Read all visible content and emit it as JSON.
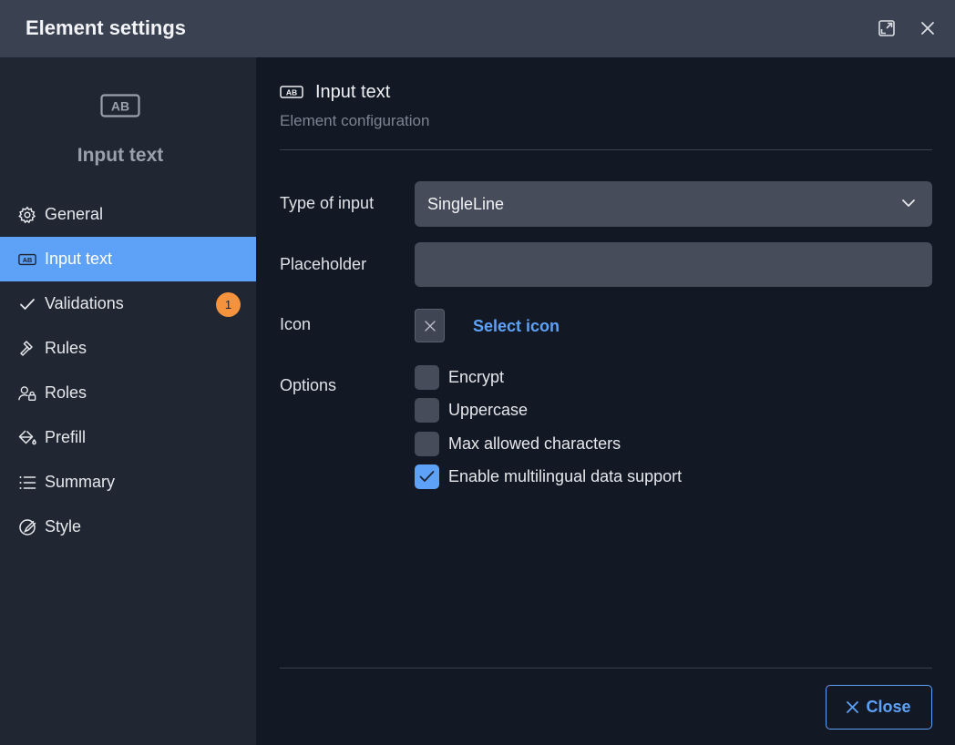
{
  "window": {
    "title": "Element settings"
  },
  "sidebar": {
    "header_title": "Input text",
    "items": [
      {
        "label": "General"
      },
      {
        "label": "Input text"
      },
      {
        "label": "Validations",
        "badge": "1"
      },
      {
        "label": "Rules"
      },
      {
        "label": "Roles"
      },
      {
        "label": "Prefill"
      },
      {
        "label": "Summary"
      },
      {
        "label": "Style"
      }
    ],
    "active_item": "Input text"
  },
  "main": {
    "title": "Input text",
    "subtitle": "Element configuration",
    "type_of_input": {
      "label": "Type of input",
      "value": "SingleLine"
    },
    "placeholder": {
      "label": "Placeholder",
      "value": ""
    },
    "icon": {
      "label": "Icon",
      "select_label": "Select icon"
    },
    "options": {
      "label": "Options",
      "items": [
        {
          "label": "Encrypt",
          "checked": false
        },
        {
          "label": "Uppercase",
          "checked": false
        },
        {
          "label": "Max allowed characters",
          "checked": false
        },
        {
          "label": "Enable multilingual data support",
          "checked": true
        }
      ]
    },
    "close_label": "Close"
  },
  "colors": {
    "accent": "#5ea2f7",
    "badge": "#f5923e",
    "titlebar": "#3a4150",
    "sidebar": "#202733",
    "main": "#131825"
  }
}
